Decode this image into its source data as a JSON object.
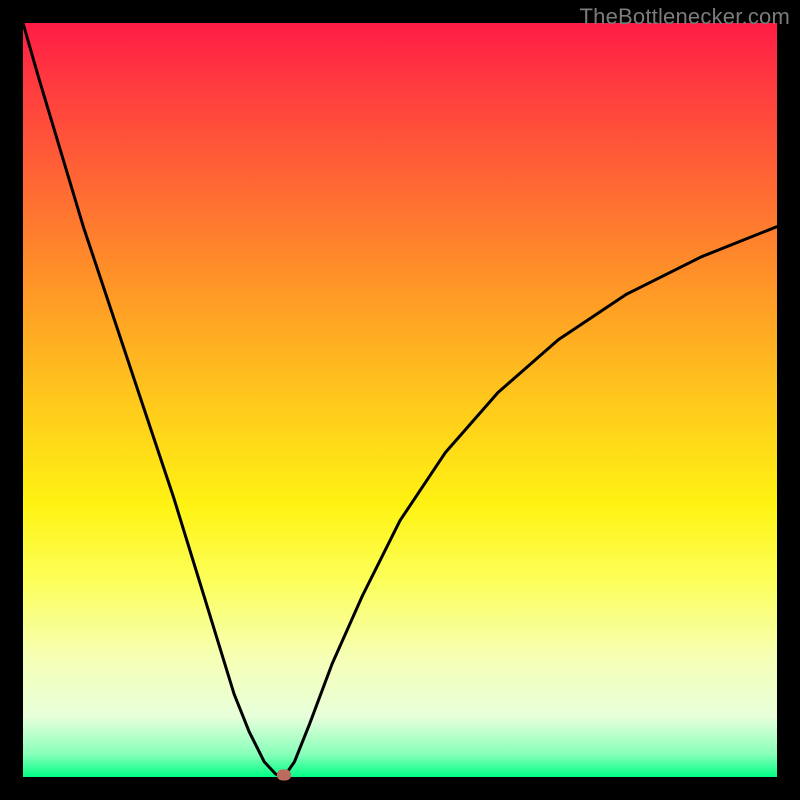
{
  "watermark": "TheBottlenecker.com",
  "chart_data": {
    "type": "line",
    "title": "",
    "xlabel": "",
    "ylabel": "",
    "xlim": [
      0,
      100
    ],
    "ylim": [
      0,
      100
    ],
    "x": [
      0,
      2,
      5,
      8,
      12,
      16,
      20,
      24,
      28,
      30,
      32,
      33.5,
      34.6,
      36,
      38,
      41,
      45,
      50,
      56,
      63,
      71,
      80,
      90,
      100
    ],
    "y": [
      100,
      93,
      83,
      73,
      61,
      49,
      37,
      24,
      11,
      6,
      2,
      0.4,
      0,
      2,
      7,
      15,
      24,
      34,
      43,
      51,
      58,
      64,
      69,
      73
    ],
    "minimum": {
      "x": 34.6,
      "y": 0
    },
    "gradient_meaning": "vertical color scale from red (high bottleneck) at top to green (optimal) at bottom",
    "marker": {
      "x": 34.6,
      "y": 0.3,
      "color": "#bd6a5f"
    }
  },
  "colors": {
    "curve": "#000000",
    "background_border": "#000000",
    "marker": "#bd6a5f",
    "watermark": "#7b7b7b"
  }
}
